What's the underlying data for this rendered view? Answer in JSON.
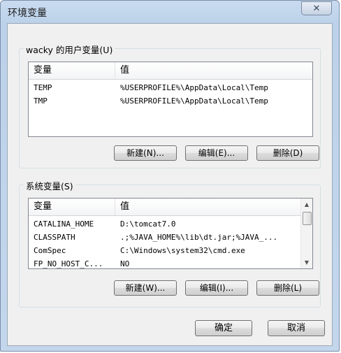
{
  "window": {
    "title": "环境变量",
    "close_glyph": "✕"
  },
  "user_vars": {
    "group_label": "wacky 的用户变量(U)",
    "columns": [
      "变量",
      "值"
    ],
    "rows": [
      {
        "name": "TEMP",
        "value": "%USERPROFILE%\\AppData\\Local\\Temp"
      },
      {
        "name": "TMP",
        "value": "%USERPROFILE%\\AppData\\Local\\Temp"
      }
    ],
    "buttons": {
      "new": "新建(N)...",
      "edit": "编辑(E)...",
      "delete": "删除(D)"
    }
  },
  "system_vars": {
    "group_label": "系统变量(S)",
    "columns": [
      "变量",
      "值"
    ],
    "rows": [
      {
        "name": "CATALINA_HOME",
        "value": "D:\\tomcat7.0"
      },
      {
        "name": "CLASSPATH",
        "value": ".;%JAVA_HOME%\\lib\\dt.jar;%JAVA_..."
      },
      {
        "name": "ComSpec",
        "value": "C:\\Windows\\system32\\cmd.exe"
      },
      {
        "name": "FP_NO_HOST_C...",
        "value": "NO"
      }
    ],
    "scroll_up_glyph": "▲",
    "scroll_down_glyph": "▼",
    "buttons": {
      "new": "新建(W)...",
      "edit": "编辑(I)...",
      "delete": "删除(L)"
    }
  },
  "footer": {
    "ok": "确定",
    "cancel": "取消"
  }
}
